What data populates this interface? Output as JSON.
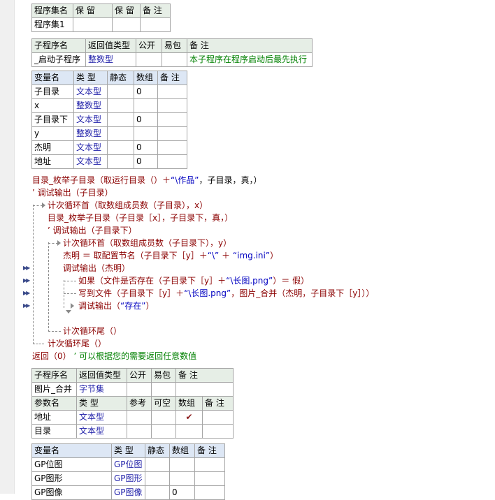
{
  "assembly_table": {
    "headers": [
      "程序集名",
      "保 留",
      "保 留",
      "备 注"
    ],
    "row": [
      "程序集1",
      "",
      "",
      ""
    ]
  },
  "sub1_table": {
    "headers": [
      "子程序名",
      "返回值类型",
      "公开",
      "易包",
      "备 注"
    ],
    "row": [
      "_启动子程序",
      "整数型",
      "",
      "",
      "本子程序在程序启动后最先执行"
    ]
  },
  "var1_table": {
    "headers": [
      "变量名",
      "类 型",
      "静态",
      "数组",
      "备 注"
    ],
    "rows": [
      [
        "子目录",
        "文本型",
        "",
        "0",
        ""
      ],
      [
        "x",
        "整数型",
        "",
        "",
        ""
      ],
      [
        "子目录下",
        "文本型",
        "",
        "0",
        ""
      ],
      [
        "y",
        "整数型",
        "",
        "",
        ""
      ],
      [
        "杰明",
        "文本型",
        "",
        "0",
        ""
      ],
      [
        "地址",
        "文本型",
        "",
        "0",
        ""
      ]
    ]
  },
  "code": {
    "l1": "目录_枚举子目录（取运行目录（）＋",
    "l1s": "“\\作品”",
    "l1e": "，子目录，真，）",
    "l2": "’ 调试输出（子目录）",
    "l3": "计次循环首（取数组成员数（子目录），x）",
    "l4": "目录_枚举子目录（子目录［x］，子目录下，真，）",
    "l5": "’ 调试输出（子目录下）",
    "l6": "计次循环首（取数组成员数（子目录下），y）",
    "l7a": "杰明 ＝ 取配置节名（子目录下［y］＋",
    "l7s1": "“\\”",
    "l7b": "＋",
    "l7s2": "“img.ini”",
    "l7c": "）",
    "l8": "调试输出（杰明）",
    "l9a": "如果（文件是否存在（子目录下［y］＋",
    "l9s": "“\\长图.png”",
    "l9b": "）＝ 假）",
    "l10a": "写到文件（子目录下［y］＋",
    "l10s": "“\\长图.png”",
    "l10b": "，图片_合并（杰明，子目录下［y］））",
    "l11a": "调试输出（",
    "l11s": "“存在”",
    "l11b": "）",
    "l12": "计次循环尾（）",
    "l13": "计次循环尾（）",
    "l14a": "返回（0）",
    "l14c": "’ 可以根据您的需要返回任意数值"
  },
  "sub2_table": {
    "headers": [
      "子程序名",
      "返回值类型",
      "公开",
      "易包",
      "备 注"
    ],
    "row": [
      "图片_合并",
      "字节集",
      "",
      "",
      ""
    ]
  },
  "param_table": {
    "headers": [
      "参数名",
      "类 型",
      "参考",
      "可空",
      "数组",
      "备 注"
    ],
    "rows": [
      [
        "地址",
        "文本型",
        "",
        "",
        "✔",
        ""
      ],
      [
        "目录",
        "文本型",
        "",
        "",
        "",
        ""
      ]
    ]
  },
  "var2_table": {
    "headers": [
      "变量名",
      "类 型",
      "静态",
      "数组",
      "备 注"
    ],
    "rows": [
      [
        "GP位图",
        "GP位图",
        "",
        "",
        ""
      ],
      [
        "GP图形",
        "GP图形",
        "",
        "",
        ""
      ],
      [
        "GP图像",
        "GP图像",
        "",
        "0",
        ""
      ]
    ]
  },
  "colors": {
    "type_text": "#1f1fa8",
    "comment": "#008000",
    "code_call": "#8b0000",
    "string": "#0000c0"
  }
}
